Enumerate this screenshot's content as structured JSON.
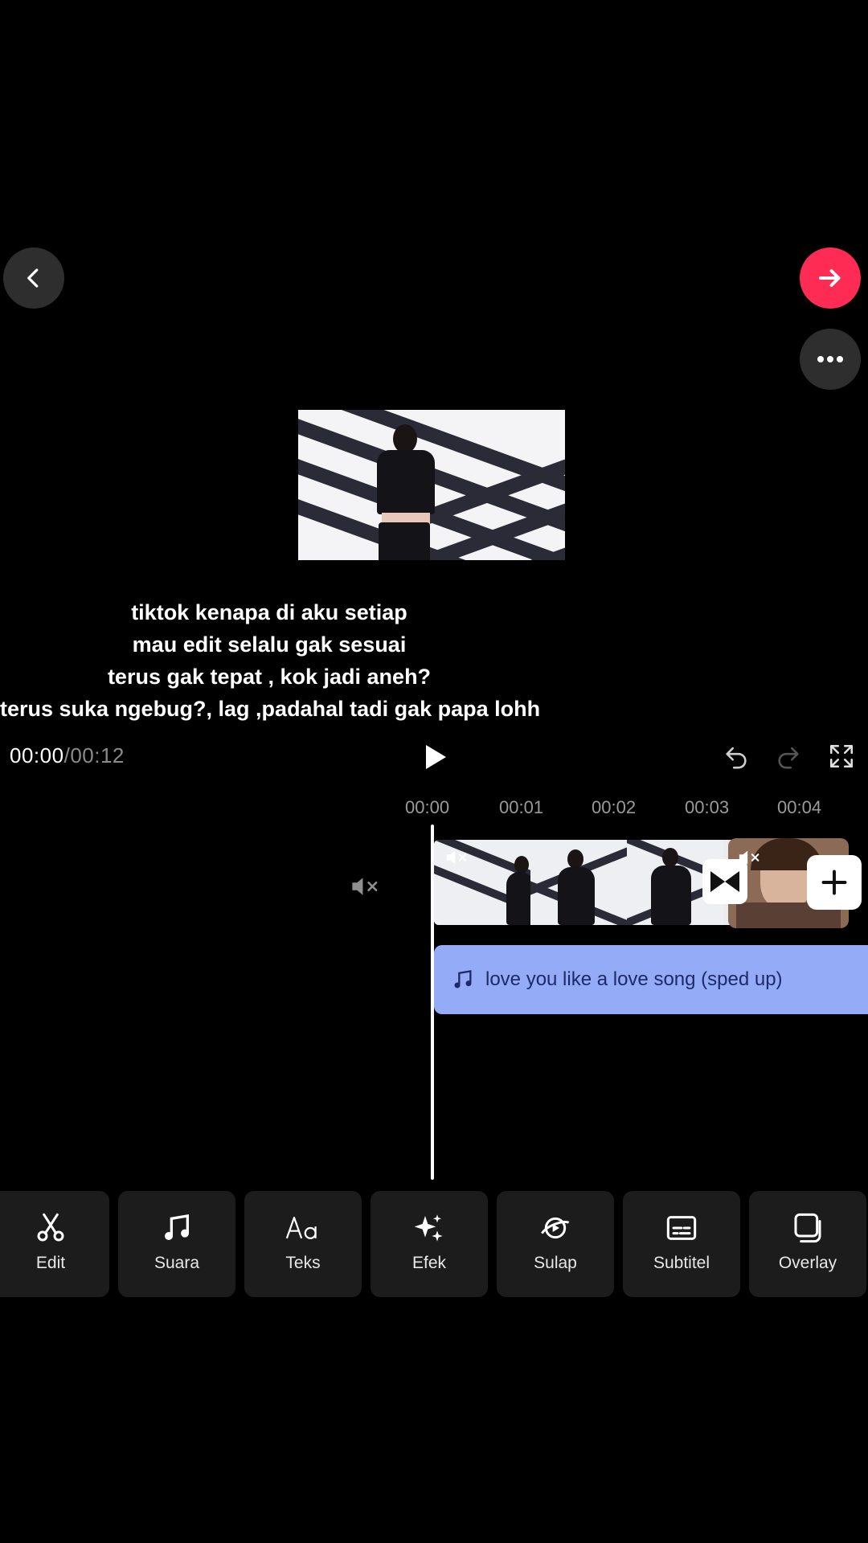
{
  "player": {
    "current_time": "00:00",
    "separator": "/",
    "total_time": "00:12"
  },
  "caption_lines": [
    "tiktok kenapa di aku setiap",
    "mau edit selalu gak sesuai",
    "terus gak tepat , kok jadi aneh?",
    "terus suka ngebug?, lag ,padahal tadi gak papa lohh"
  ],
  "timeline": {
    "ticks": [
      "00:00",
      "00:01",
      "00:02",
      "00:03",
      "00:04"
    ],
    "audio_track_label": "love you like a love song (sped up)"
  },
  "toolbar": {
    "items": [
      {
        "label": "Edit",
        "icon": "scissors-icon"
      },
      {
        "label": "Suara",
        "icon": "music-note-icon"
      },
      {
        "label": "Teks",
        "icon": "text-aa-icon"
      },
      {
        "label": "Efek",
        "icon": "sparkle-icon"
      },
      {
        "label": "Sulap",
        "icon": "magic-icon"
      },
      {
        "label": "Subtitel",
        "icon": "subtitle-icon"
      },
      {
        "label": "Overlay",
        "icon": "overlay-icon"
      }
    ]
  },
  "colors": {
    "next_button": "#fe2c55",
    "audio_track": "#94acf7"
  }
}
